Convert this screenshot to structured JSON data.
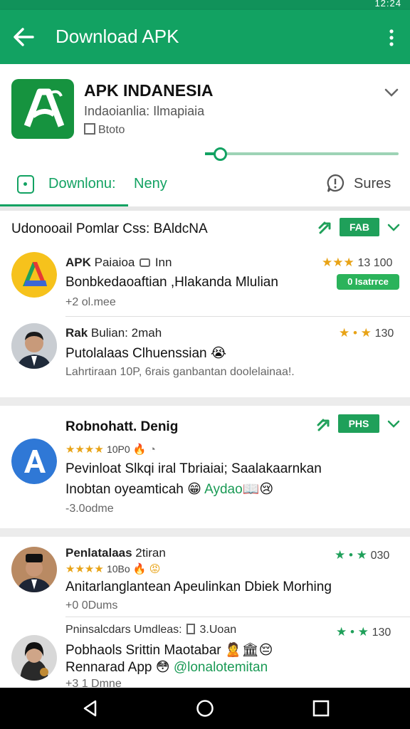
{
  "status": {
    "clock": "12:24"
  },
  "appbar": {
    "title": "Download APK"
  },
  "app": {
    "name": "APK INDANESIA",
    "subtitle": "Indaoianlia: Ilmapiaia",
    "meta": "Btoto"
  },
  "tabs": [
    {
      "label": "Downlonu:"
    },
    {
      "label": "Neny"
    },
    {
      "label": "Sures"
    }
  ],
  "sections": [
    {
      "title": "Udonooail Pomlar Css: BAldcNA",
      "pill": "FAB",
      "items": [
        {
          "title_bold": "APK",
          "title_rest": "Paiaioa",
          "title_after": "Inn",
          "line1": "Bonbkedaoaftian ,Hlakanda Mlulian",
          "sub": "+2 ol.mee",
          "stars": "★★★",
          "rating": "13 100",
          "badge": "0 Isatrrce"
        },
        {
          "title_bold": "Rak",
          "title_rest": "Bulian: 2mah",
          "line1": "Putolalaas Clhuenssian 😭",
          "sub": "Lahrtiraan 10P, 6rais ganbantan doolelainaa!.",
          "stars": "★ • ★",
          "rating": "130"
        }
      ]
    },
    {
      "title": "Robnohatt. Denig",
      "pill": "PHS",
      "items": [
        {
          "stars_prefix": "★★★★",
          "prefix_num": "10P0",
          "line1": "Pevinloat Slkqi iral Tbriaiai; Saalakaarnkan",
          "line2_a": "Inobtan oyeamticah 😁",
          "line2_b": "Aydao",
          "line2_c": "📖😢",
          "sub": "-3.0odme"
        }
      ]
    },
    {
      "items": [
        {
          "title": "Penlatalaas",
          "title_rest": "2tiran",
          "stars_prefix": "★★★★",
          "prefix_num": "10Bo",
          "line1": "Anitarlanglantean Apeulinkan Dbiek Morhing",
          "sub": "+0 0Dums",
          "stars": "★ • ★",
          "rating": "030"
        },
        {
          "title": "Pninsalcdars Umdleas:",
          "title_after": "3.Uoan",
          "line1": "Pobhaols Srittin Maotabar 🙎🏛😔",
          "line2_a": "Rennarad App 😳",
          "line2_b": "@lonalotemitan",
          "sub": "+3 1 Dmne",
          "stars": "★ • ★",
          "rating": "130"
        }
      ]
    }
  ],
  "colors": {
    "brand": "#12a262",
    "star": "#e8a316",
    "badge": "#2bb35b"
  }
}
